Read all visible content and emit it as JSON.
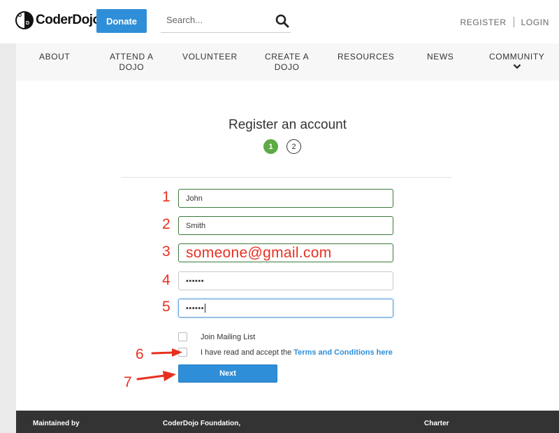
{
  "header": {
    "logo_text": "CoderDojo",
    "logo_mark_letters": [
      "D",
      "D"
    ],
    "donate_label": "Donate",
    "search_placeholder": "Search...",
    "register_label": "REGISTER",
    "login_label": "LOGIN",
    "icons": {
      "search": "search-icon",
      "logo": "coderdojo-logo-icon"
    }
  },
  "nav": {
    "items": [
      {
        "label": "ABOUT"
      },
      {
        "label": "ATTEND A\nDOJO"
      },
      {
        "label": "VOLUNTEER"
      },
      {
        "label": "CREATE A\nDOJO"
      },
      {
        "label": "RESOURCES"
      },
      {
        "label": "NEWS"
      },
      {
        "label": "COMMUNITY"
      }
    ],
    "community_icon": "chevron-down-icon"
  },
  "form": {
    "title": "Register an account",
    "steps": [
      "1",
      "2"
    ],
    "current_step": "1",
    "fields": {
      "first_name": "John",
      "last_name": "Smith",
      "email": "someone@gmail.com",
      "password": "••••••",
      "confirm_password": "••••••"
    },
    "mailing_list_label": "Join Mailing List",
    "terms_text": "I have read and accept the",
    "terms_link": "Terms and Conditions here",
    "next_label": "Next"
  },
  "annotations": {
    "numbers": [
      "1",
      "2",
      "3",
      "4",
      "5",
      "6",
      "7"
    ],
    "color": "#e83020"
  },
  "footer": {
    "col1": "Maintained by",
    "col2": "CoderDojo Foundation,",
    "col3": "Charter"
  },
  "colors": {
    "accent": "#2f8ed8",
    "step_active": "#5eaa45",
    "field_valid_border": "#3c7a3c",
    "footer_bg": "#333333"
  }
}
